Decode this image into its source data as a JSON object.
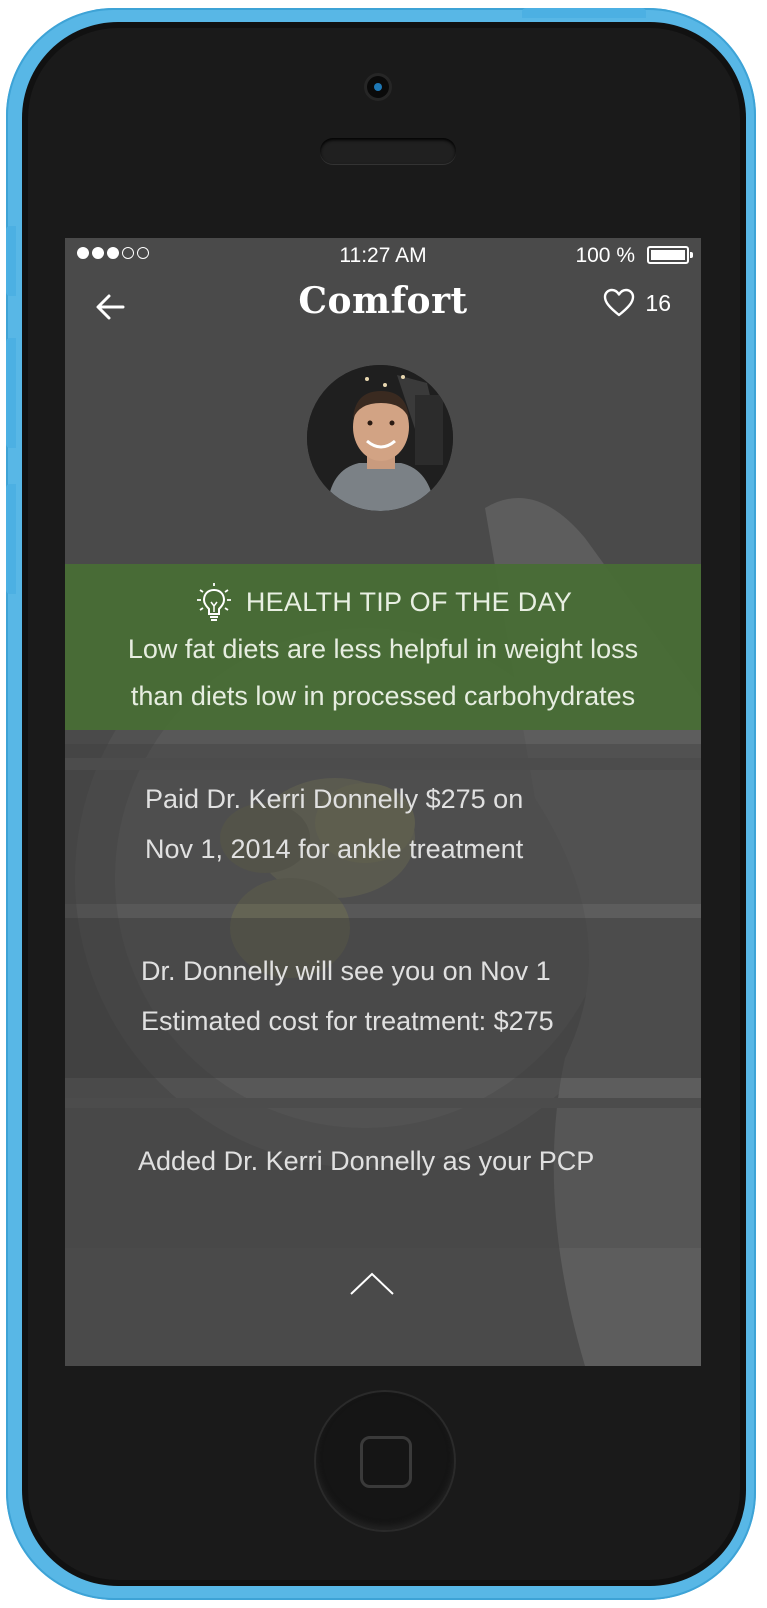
{
  "status_bar": {
    "signal_dots": [
      true,
      true,
      true,
      false,
      false
    ],
    "time": "11:27 AM",
    "battery": "100 %"
  },
  "nav": {
    "back_icon": "arrow-left-icon",
    "title": "Comfort",
    "like_icon": "heart-outline-icon",
    "like_count": "16"
  },
  "profile": {
    "avatar_icon": "user-avatar-photo"
  },
  "health_tip": {
    "icon": "lightbulb-icon",
    "title": "HEALTH TIP OF THE DAY",
    "line1": "Low fat diets are less helpful in weight loss",
    "line2": "than diets low in processed carbohydrates",
    "color": "#4a7236"
  },
  "feed": [
    {
      "line1": "Paid Dr. Kerri Donnelly $275 on",
      "line2": "Nov 1, 2014 for ankle treatment"
    },
    {
      "line1": "Dr. Donnelly will see you on Nov 1",
      "line2": "Estimated cost for treatment: $275"
    },
    {
      "line1": "Added Dr. Kerri Donnelly as your PCP"
    }
  ],
  "scroll_icon": "chevron-up-icon",
  "device": {
    "case_color": "#58b7e6"
  }
}
